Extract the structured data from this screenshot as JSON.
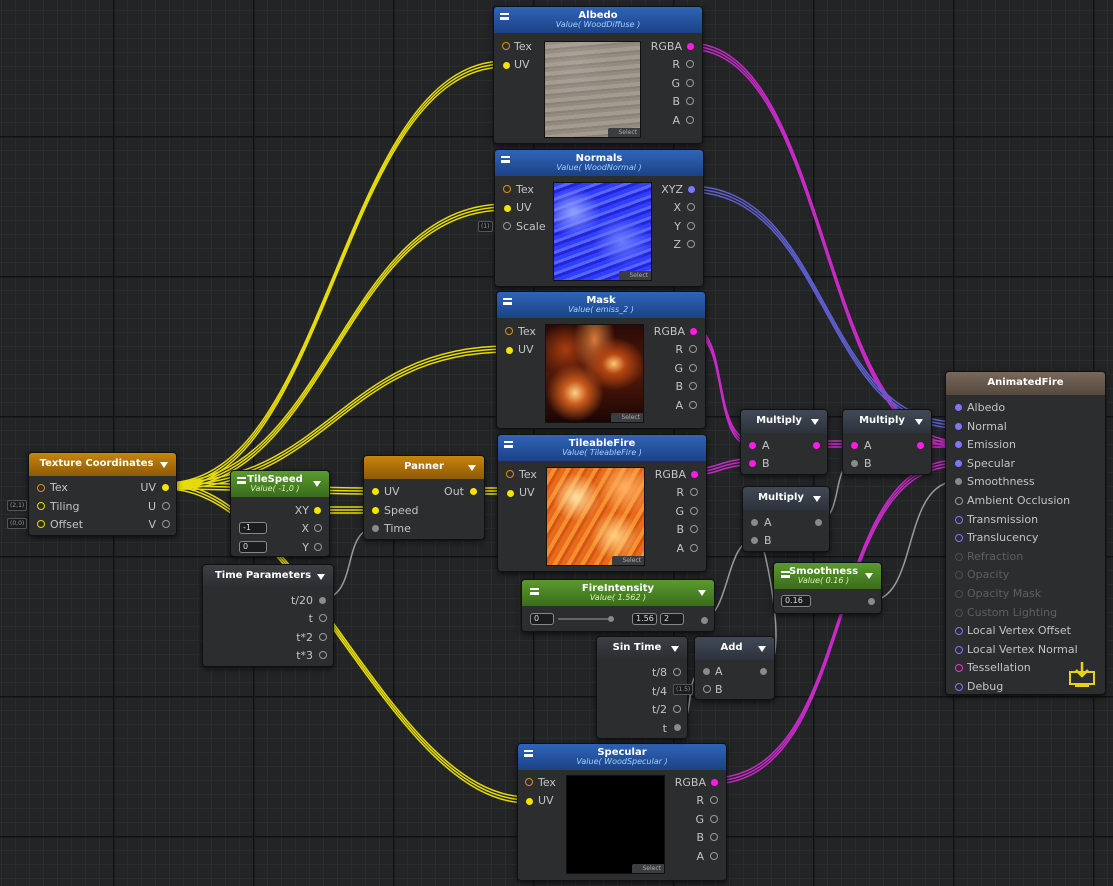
{
  "nodes": {
    "albedo": {
      "title": "Albedo",
      "sub": "Value( WoodDiffuse )",
      "inputs": [
        "Tex",
        "UV"
      ],
      "outputs": [
        "RGBA",
        "R",
        "G",
        "B",
        "A"
      ],
      "select": "Select"
    },
    "normals": {
      "title": "Normals",
      "sub": "Value( WoodNormal )",
      "inputs": [
        "Tex",
        "UV",
        "Scale"
      ],
      "outputs": [
        "XYZ",
        "X",
        "Y",
        "Z"
      ],
      "select": "Select",
      "scale_default": "(1)"
    },
    "mask": {
      "title": "Mask",
      "sub": "Value( emiss_2 )",
      "inputs": [
        "Tex",
        "UV"
      ],
      "outputs": [
        "RGBA",
        "R",
        "G",
        "B",
        "A"
      ],
      "select": "Select"
    },
    "tileablefire": {
      "title": "TileableFire",
      "sub": "Value( TileableFire )",
      "inputs": [
        "Tex",
        "UV"
      ],
      "outputs": [
        "RGBA",
        "R",
        "G",
        "B",
        "A"
      ],
      "select": "Select"
    },
    "specular": {
      "title": "Specular",
      "sub": "Value( WoodSpecular )",
      "inputs": [
        "Tex",
        "UV"
      ],
      "outputs": [
        "RGBA",
        "R",
        "G",
        "B",
        "A"
      ],
      "select": "Select"
    },
    "texcoords": {
      "title": "Texture Coordinates",
      "inputs": [
        "Tex",
        "Tiling",
        "Offset"
      ],
      "outputs": [
        "UV",
        "U",
        "V"
      ],
      "tiling_default": "(2,1)",
      "offset_default": "(0,0)"
    },
    "tilespeed": {
      "title": "TileSpeed",
      "sub": "Value( -1,0 )",
      "outputs": [
        "XY",
        "X",
        "Y"
      ],
      "x_value": "-1",
      "y_value": "0"
    },
    "panner": {
      "title": "Panner",
      "inputs": [
        "UV",
        "Speed",
        "Time"
      ],
      "outputs": [
        "Out"
      ]
    },
    "timeparams": {
      "title": "Time Parameters",
      "outputs": [
        "t/20",
        "t",
        "t*2",
        "t*3"
      ]
    },
    "fireintensity": {
      "title": "FireIntensity",
      "sub": "Value( 1.562 )",
      "min": "0",
      "value": "1.56",
      "max": "2"
    },
    "multiply1": {
      "title": "Multiply",
      "inputs": [
        "A",
        "B"
      ]
    },
    "multiply2": {
      "title": "Multiply",
      "inputs": [
        "A",
        "B"
      ]
    },
    "multiply3": {
      "title": "Multiply",
      "inputs": [
        "A",
        "B"
      ]
    },
    "smoothness": {
      "title": "Smoothness",
      "sub": "Value( 0.16 )",
      "value": "0.16"
    },
    "sintime": {
      "title": "Sin Time",
      "outputs": [
        "t/8",
        "t/4",
        "t/2",
        "t"
      ]
    },
    "add": {
      "title": "Add",
      "inputs": [
        "A",
        "B"
      ],
      "b_default": "(1.5)"
    },
    "master": {
      "title": "AnimatedFire",
      "inputs": [
        {
          "label": "Albedo",
          "state": "connected"
        },
        {
          "label": "Normal",
          "state": "connected"
        },
        {
          "label": "Emission",
          "state": "connected"
        },
        {
          "label": "Specular",
          "state": "connected"
        },
        {
          "label": "Smoothness",
          "state": "connected"
        },
        {
          "label": "Ambient Occlusion",
          "state": "open"
        },
        {
          "label": "Transmission",
          "state": "open"
        },
        {
          "label": "Translucency",
          "state": "open"
        },
        {
          "label": "Refraction",
          "state": "disabled"
        },
        {
          "label": "Opacity",
          "state": "disabled"
        },
        {
          "label": "Opacity Mask",
          "state": "disabled"
        },
        {
          "label": "Custom Lighting",
          "state": "disabled"
        },
        {
          "label": "Local Vertex Offset",
          "state": "open"
        },
        {
          "label": "Local Vertex Normal",
          "state": "open"
        },
        {
          "label": "Tessellation",
          "state": "open"
        },
        {
          "label": "Debug",
          "state": "open"
        }
      ]
    }
  },
  "colors": {
    "uv_wire": "#f0e40a",
    "color_wire": "#d42bd4",
    "normal_wire": "#6a6ad8",
    "float_wire": "#9a9a9a",
    "header_blue": "#2a5aa8",
    "header_orange": "#b9790c",
    "header_green": "#4f8a28"
  },
  "icons": {
    "menu": "hamburger-icon",
    "dropdown": "triangle-down-icon",
    "save": "save-download-icon"
  }
}
